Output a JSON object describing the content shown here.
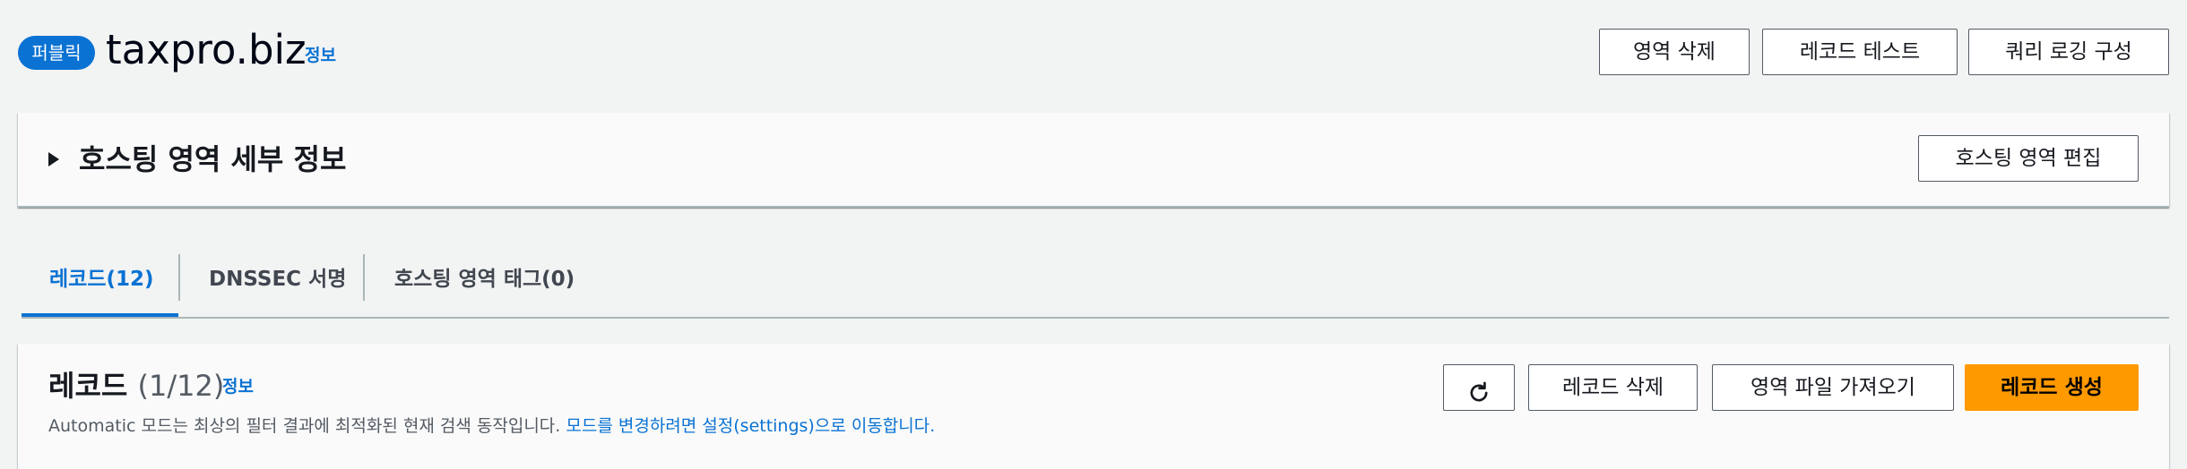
{
  "header": {
    "badge": "퍼블릭",
    "title": "taxpro.biz",
    "info": "정보",
    "buttons": {
      "delete_zone": "영역 삭제",
      "test_record": "레코드 테스트",
      "query_logging": "쿼리 로깅 구성"
    }
  },
  "details": {
    "title": "호스팅 영역 세부 정보",
    "edit_button": "호스팅 영역 편집",
    "expanded": false
  },
  "tabs": [
    {
      "label": "레코드(12)",
      "active": true
    },
    {
      "label": "DNSSEC 서명",
      "active": false
    },
    {
      "label": "호스팅 영역 태그(0)",
      "active": false
    }
  ],
  "records": {
    "title": "레코드",
    "count": "(1/12)",
    "info": "정보",
    "description": "Automatic 모드는 최상의 필터 결과에 최적화된 현재 검색 동작입니다.",
    "description_link": "모드를 변경하려면 설정(settings)으로 이동합니다.",
    "buttons": {
      "refresh_icon": "refresh-icon",
      "delete": "레코드 삭제",
      "import_zone_file": "영역 파일 가져오기",
      "create": "레코드 생성"
    }
  },
  "colors": {
    "accent": "#0972d3",
    "primary_button": "#ff9900",
    "background": "#f2f3f3"
  }
}
